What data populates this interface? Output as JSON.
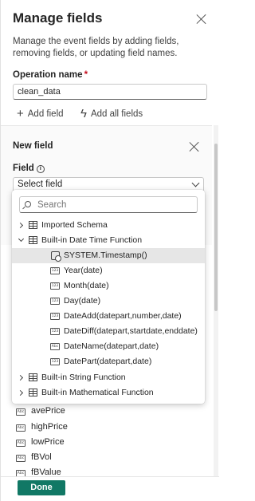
{
  "panel": {
    "title": "Manage fields",
    "description": "Manage the event fields by adding fields, removing fields, or updating field names.",
    "operation_label": "Operation name",
    "required_mark": "*",
    "operation_value": "clean_data",
    "add_field_label": "Add field",
    "add_all_fields_label": "Add all fields"
  },
  "new_field": {
    "title": "New field",
    "field_label": "Field",
    "select_placeholder": "Select field"
  },
  "dropdown": {
    "search_placeholder": "Search",
    "groups": [
      {
        "label": "Imported Schema"
      },
      {
        "label": "Built-in Date Time Function"
      },
      {
        "label": "Built-in String Function"
      },
      {
        "label": "Built-in Mathematical Function"
      }
    ],
    "datetime_items": [
      {
        "label": "SYSTEM.Timestamp()",
        "icon": "calendar-clock-icon"
      },
      {
        "label": "Year(date)",
        "icon": "number-type-icon"
      },
      {
        "label": "Month(date)",
        "icon": "number-type-icon"
      },
      {
        "label": "Day(date)",
        "icon": "number-type-icon"
      },
      {
        "label": "DateAdd(datepart,number,date)",
        "icon": "number-type-icon"
      },
      {
        "label": "DateDiff(datepart,startdate,enddate)",
        "icon": "number-type-icon"
      },
      {
        "label": "DateName(datepart,date)",
        "icon": "text-type-icon"
      },
      {
        "label": "DatePart(datepart,date)",
        "icon": "number-type-icon"
      }
    ]
  },
  "fields": [
    "avePrice",
    "highPrice",
    "lowPrice",
    "fBVol",
    "fBValue"
  ],
  "icons": {
    "number": "123",
    "text": "Abc"
  },
  "footer": {
    "done_label": "Done"
  },
  "colors": {
    "primary": "#117865",
    "required": "#c50f1f"
  }
}
